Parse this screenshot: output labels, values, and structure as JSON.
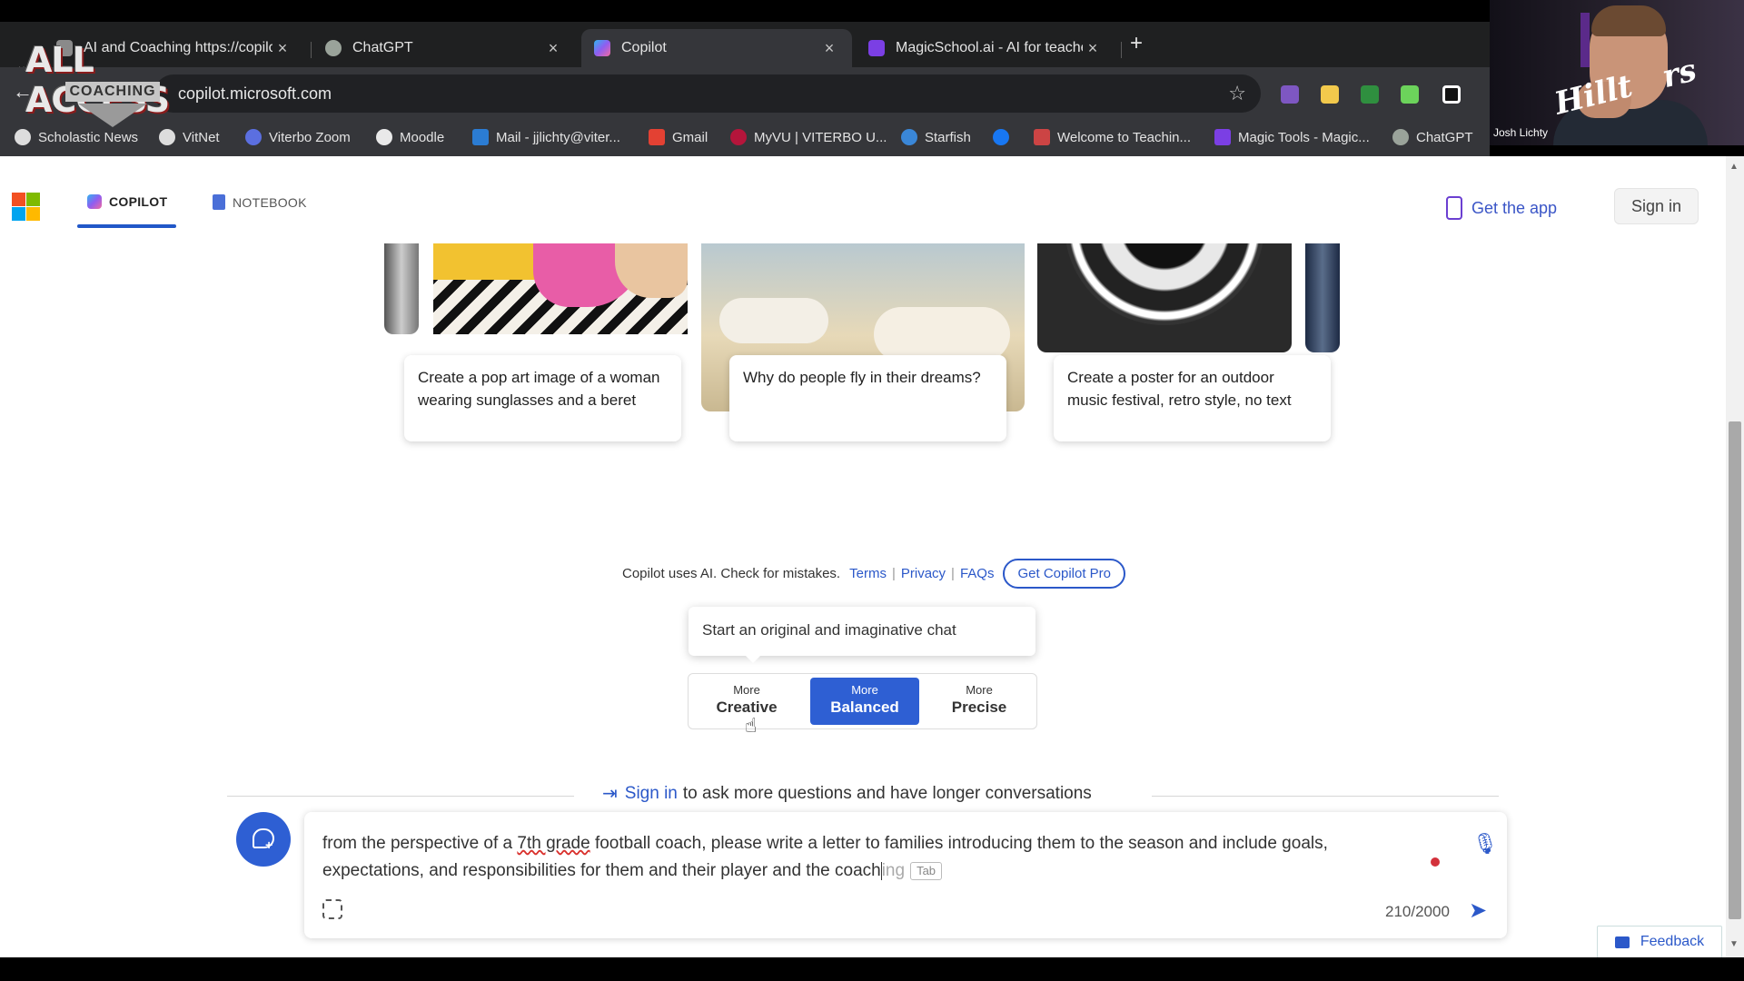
{
  "browser": {
    "tabs": [
      {
        "title": "AI and Coaching https://copilot.",
        "favicon_color": "#8a8a8a",
        "active": false
      },
      {
        "title": "ChatGPT",
        "favicon_color": "#9aa39a",
        "active": false
      },
      {
        "title": "Copilot",
        "favicon_color": "#4f8df5",
        "active": true
      },
      {
        "title": "MagicSchool.ai - AI for teachers",
        "favicon_color": "#7b3fe4",
        "active": false
      }
    ],
    "new_tab": "+",
    "url": "copilot.microsoft.com",
    "bookmarks": [
      {
        "label": "Scholastic News",
        "color": "#dddddd"
      },
      {
        "label": "VitNet",
        "color": "#dddddd"
      },
      {
        "label": "Viterbo Zoom",
        "color": "#5b6fe0"
      },
      {
        "label": "Moodle",
        "color": "#e9e9e9"
      },
      {
        "label": "Mail - jjlichty@viter...",
        "color": "#2b7cd3"
      },
      {
        "label": "Gmail",
        "color": "#e34133"
      },
      {
        "label": "MyVU | VITERBO U...",
        "color": "#b5153b"
      },
      {
        "label": "Starfish",
        "color": "#3a87d8"
      },
      {
        "label": "",
        "color": "#1877f2"
      },
      {
        "label": "Welcome to Teachin...",
        "color": "#c44"
      },
      {
        "label": "Magic Tools - Magic...",
        "color": "#7b3fe4"
      },
      {
        "label": "ChatGPT",
        "color": "#9aa39a"
      }
    ]
  },
  "overlay": {
    "logo_top": "ALL ACCESS",
    "logo_bottom": "COACHING",
    "webcam_name": "Josh Lichty"
  },
  "header": {
    "tabs": [
      {
        "label": "COPILOT",
        "active": true
      },
      {
        "label": "NOTEBOOK",
        "active": false
      }
    ],
    "get_app": "Get the app",
    "sign_in": "Sign in"
  },
  "suggestions": [
    {
      "text": "Create a pop art image of a woman wearing sunglasses and a beret"
    },
    {
      "text": "Why do people fly in their dreams?"
    },
    {
      "text": "Create a poster for an outdoor music festival, retro style, no text"
    }
  ],
  "disclaimer": {
    "text": "Copilot uses AI. Check for mistakes.",
    "terms": "Terms",
    "privacy": "Privacy",
    "faqs": "FAQs",
    "pro": "Get Copilot Pro"
  },
  "tooltip": "Start an original and imaginative chat",
  "tones": [
    {
      "small": "More",
      "big": "Creative",
      "selected": false
    },
    {
      "small": "More",
      "big": "Balanced",
      "selected": true
    },
    {
      "small": "More",
      "big": "Precise",
      "selected": false
    }
  ],
  "signin_prompt": {
    "link": "Sign in",
    "text": "to ask more questions and have longer conversations"
  },
  "composer": {
    "text_before": "from the perspective of a ",
    "underlined": "7th grade",
    "text_after": " football coach, please write a letter to families introducing them to the season and include goals, expectations, and responsibilities for them and their player and the coach",
    "ghost": "ing",
    "tab_hint": "Tab",
    "counter": "210/2000"
  },
  "feedback": "Feedback"
}
